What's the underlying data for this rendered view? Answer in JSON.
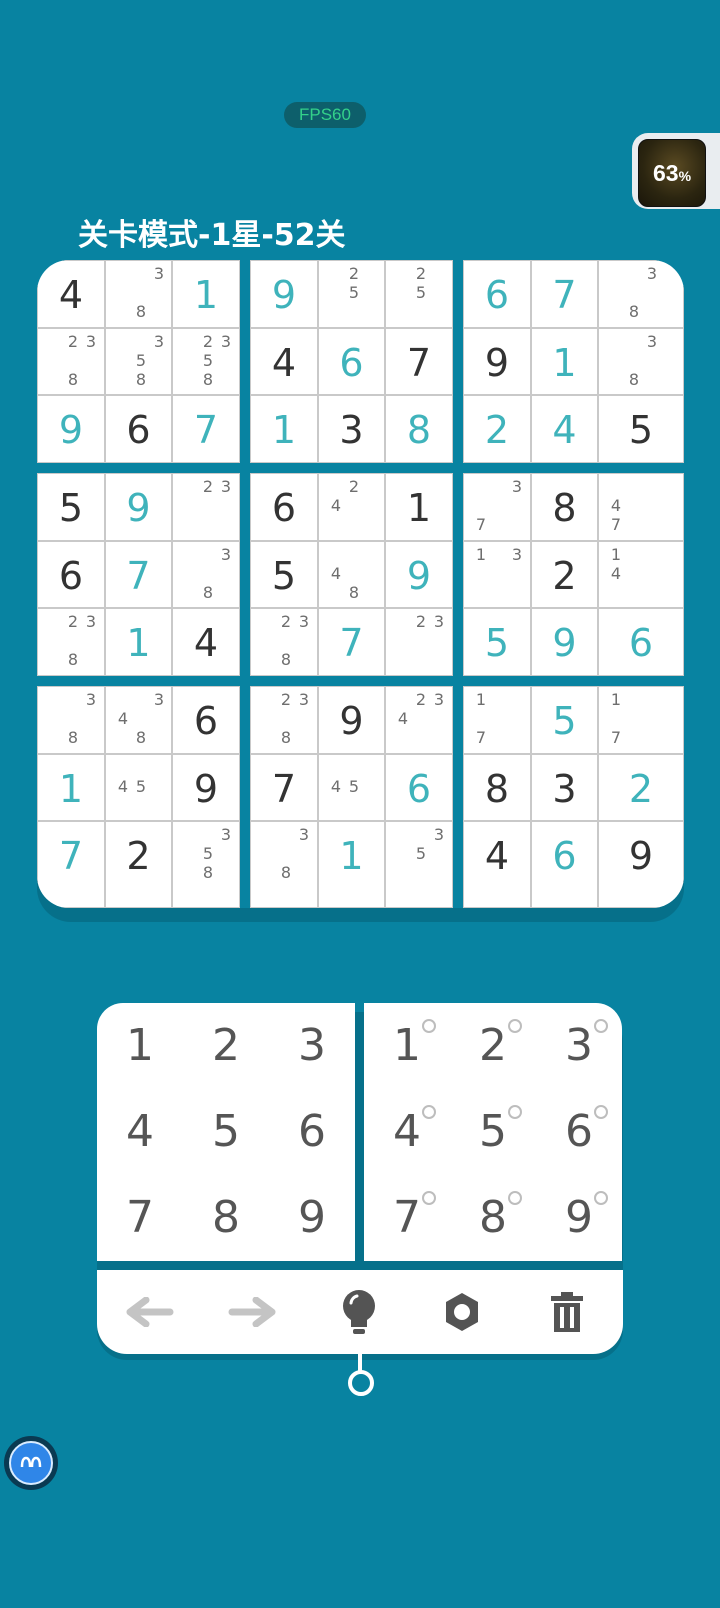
{
  "fps_label": "FPS60",
  "progress_badge": {
    "value": "63",
    "unit": "%"
  },
  "level_title": "关卡模式-1星-52关",
  "grid": [
    [
      {
        "v": "4",
        "t": "g"
      },
      {
        "n": [
          3,
          8
        ]
      },
      {
        "v": "1",
        "t": "u"
      },
      {
        "v": "9",
        "t": "u"
      },
      {
        "n": [
          2,
          5
        ]
      },
      {
        "n": [
          2,
          5
        ]
      },
      {
        "v": "6",
        "t": "u"
      },
      {
        "v": "7",
        "t": "u"
      },
      {
        "n": [
          3,
          8
        ]
      }
    ],
    [
      {
        "n": [
          2,
          3,
          8
        ]
      },
      {
        "n": [
          3,
          5,
          8
        ]
      },
      {
        "n": [
          2,
          3,
          5,
          8
        ]
      },
      {
        "v": "4",
        "t": "g"
      },
      {
        "v": "6",
        "t": "u"
      },
      {
        "v": "7",
        "t": "g"
      },
      {
        "v": "9",
        "t": "g"
      },
      {
        "v": "1",
        "t": "u"
      },
      {
        "n": [
          3,
          8
        ]
      }
    ],
    [
      {
        "v": "9",
        "t": "u"
      },
      {
        "v": "6",
        "t": "g"
      },
      {
        "v": "7",
        "t": "u"
      },
      {
        "v": "1",
        "t": "u"
      },
      {
        "v": "3",
        "t": "g"
      },
      {
        "v": "8",
        "t": "u"
      },
      {
        "v": "2",
        "t": "u"
      },
      {
        "v": "4",
        "t": "u"
      },
      {
        "v": "5",
        "t": "g"
      }
    ],
    [
      {
        "v": "5",
        "t": "g"
      },
      {
        "v": "9",
        "t": "u"
      },
      {
        "n": [
          2,
          3
        ]
      },
      {
        "v": "6",
        "t": "g"
      },
      {
        "n": [
          2,
          4
        ]
      },
      {
        "v": "1",
        "t": "g"
      },
      {
        "n": [
          3,
          7
        ]
      },
      {
        "v": "8",
        "t": "g"
      },
      {
        "n": [
          4,
          7
        ]
      }
    ],
    [
      {
        "v": "6",
        "t": "g"
      },
      {
        "v": "7",
        "t": "u"
      },
      {
        "n": [
          3,
          8
        ]
      },
      {
        "v": "5",
        "t": "g"
      },
      {
        "n": [
          4,
          8
        ]
      },
      {
        "v": "9",
        "t": "u"
      },
      {
        "n": [
          1,
          3
        ]
      },
      {
        "v": "2",
        "t": "g"
      },
      {
        "n": [
          1,
          4
        ]
      }
    ],
    [
      {
        "n": [
          2,
          3,
          8
        ]
      },
      {
        "v": "1",
        "t": "u"
      },
      {
        "v": "4",
        "t": "g"
      },
      {
        "n": [
          2,
          3,
          8
        ]
      },
      {
        "v": "7",
        "t": "u"
      },
      {
        "n": [
          2,
          3
        ]
      },
      {
        "v": "5",
        "t": "u"
      },
      {
        "v": "9",
        "t": "u"
      },
      {
        "v": "6",
        "t": "u"
      }
    ],
    [
      {
        "n": [
          3,
          8
        ]
      },
      {
        "n": [
          3,
          4,
          8
        ]
      },
      {
        "v": "6",
        "t": "g"
      },
      {
        "n": [
          2,
          3,
          8
        ]
      },
      {
        "v": "9",
        "t": "g"
      },
      {
        "n": [
          2,
          3,
          4
        ]
      },
      {
        "n": [
          1,
          7
        ]
      },
      {
        "v": "5",
        "t": "u"
      },
      {
        "n": [
          1,
          7
        ]
      }
    ],
    [
      {
        "v": "1",
        "t": "u"
      },
      {
        "n": [
          4,
          5
        ]
      },
      {
        "v": "9",
        "t": "g"
      },
      {
        "v": "7",
        "t": "g"
      },
      {
        "n": [
          4,
          5
        ]
      },
      {
        "v": "6",
        "t": "u"
      },
      {
        "v": "8",
        "t": "g"
      },
      {
        "v": "3",
        "t": "g"
      },
      {
        "v": "2",
        "t": "u"
      }
    ],
    [
      {
        "v": "7",
        "t": "u"
      },
      {
        "v": "2",
        "t": "g"
      },
      {
        "n": [
          3,
          5,
          8
        ]
      },
      {
        "n": [
          3,
          8
        ]
      },
      {
        "v": "1",
        "t": "u"
      },
      {
        "n": [
          3,
          5
        ]
      },
      {
        "v": "4",
        "t": "g"
      },
      {
        "v": "6",
        "t": "u"
      },
      {
        "v": "9",
        "t": "g"
      }
    ]
  ],
  "keypad_numbers": [
    "1",
    "2",
    "3",
    "4",
    "5",
    "6",
    "7",
    "8",
    "9"
  ],
  "keypad_notes": [
    "1",
    "2",
    "3",
    "4",
    "5",
    "6",
    "7",
    "8",
    "9"
  ],
  "toolbar": [
    "undo-arrow-icon",
    "redo-arrow-icon",
    "hint-bulb-icon",
    "settings-gear-icon",
    "delete-trash-icon"
  ],
  "colors": {
    "background": "#0883a1",
    "given": "#333333",
    "user": "#3fb3bb"
  }
}
